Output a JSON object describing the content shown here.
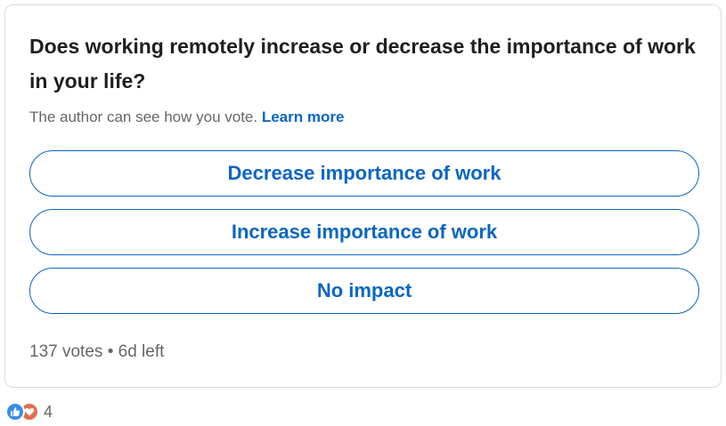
{
  "poll": {
    "question": "Does working remotely increase or decrease the importance of work in your life?",
    "visibility_note": "The author can see how you vote.",
    "learn_more_label": "Learn more",
    "options": [
      {
        "label": "Decrease importance of work"
      },
      {
        "label": "Increase importance of work"
      },
      {
        "label": "No impact"
      }
    ],
    "votes": "137 votes",
    "separator": "•",
    "time_left": "6d left"
  },
  "reactions": {
    "icons": [
      "like-icon",
      "love-icon"
    ],
    "count": "4"
  },
  "colors": {
    "accent": "#0a66c2",
    "like": "#378fe9",
    "love": "#df704d",
    "muted_text": "#666666",
    "border": "#dcdcdc"
  }
}
